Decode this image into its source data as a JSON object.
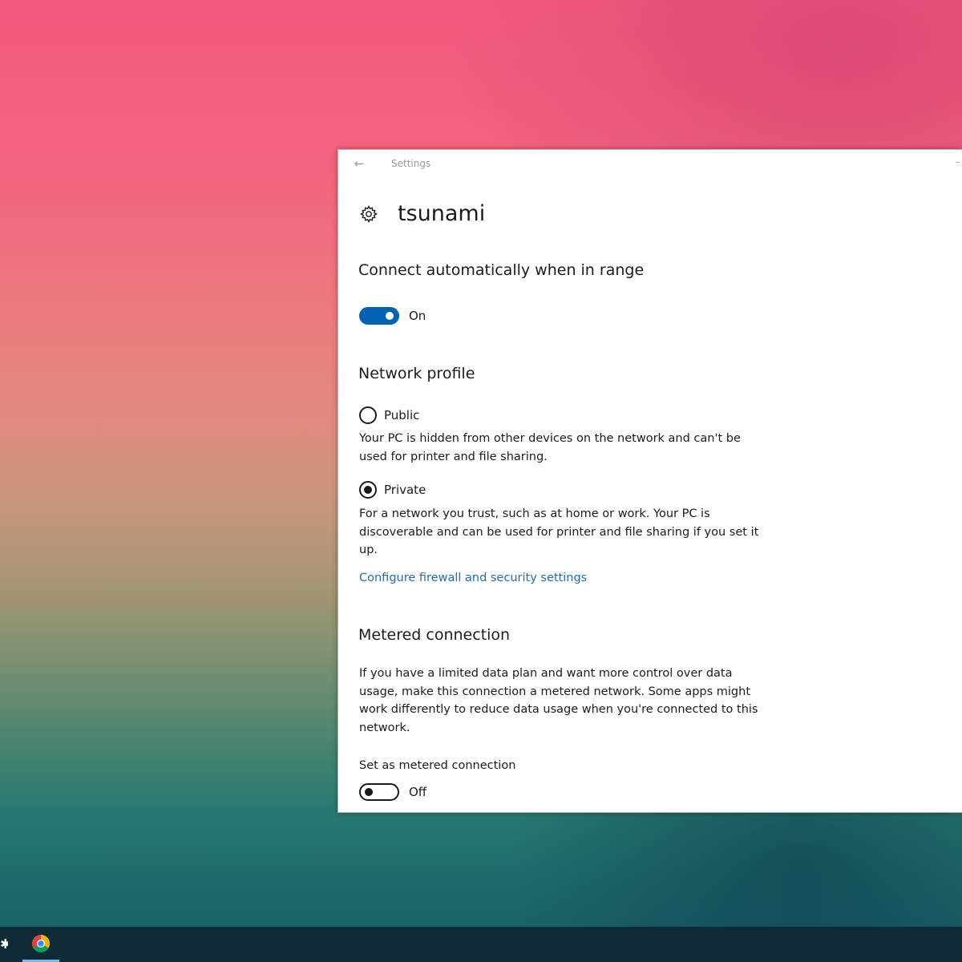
{
  "window": {
    "app_title": "Settings",
    "back_icon": "←"
  },
  "header": {
    "title": "tsunami",
    "icon": "gear-icon"
  },
  "connect_auto": {
    "title": "Connect automatically when in range",
    "state": true,
    "state_label": "On"
  },
  "network_profile": {
    "title": "Network profile",
    "options": [
      {
        "label": "Public",
        "selected": false,
        "description": "Your PC is hidden from other devices on the network and can't be used for printer and file sharing."
      },
      {
        "label": "Private",
        "selected": true,
        "description": "For a network you trust, such as at home or work. Your PC is discoverable and can be used for printer and file sharing if you set it up."
      }
    ],
    "link": "Configure firewall and security settings"
  },
  "metered": {
    "title": "Metered connection",
    "description": "If you have a limited data plan and want more control over data usage, make this connection a metered network. Some apps might work differently to reduce data usage when you're connected to this network.",
    "toggle_label": "Set as metered connection",
    "state": false,
    "state_label": "Off"
  },
  "colors": {
    "accent": "#0063b1",
    "link": "#1f6cb8",
    "taskbar": "#0d2a36"
  }
}
